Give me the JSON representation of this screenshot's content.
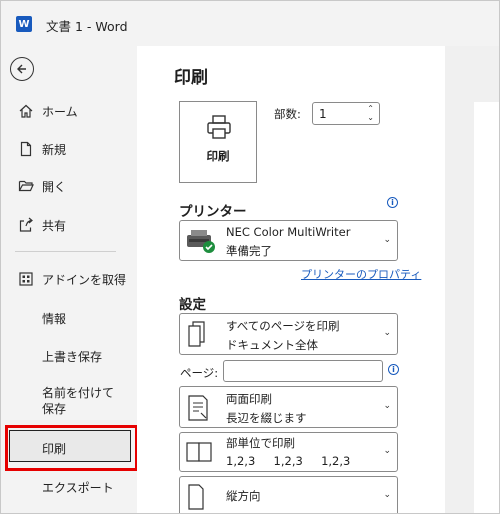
{
  "window": {
    "title": "文書 1  -  Word",
    "app_logo": "W"
  },
  "nav": {
    "items": [
      {
        "label": "ホーム",
        "icon": "home-icon"
      },
      {
        "label": "新規",
        "icon": "new-document-icon"
      },
      {
        "label": "開く",
        "icon": "folder-open-icon"
      },
      {
        "label": "共有",
        "icon": "share-icon"
      },
      {
        "label": "アドインを取得",
        "icon": "addin-icon"
      },
      {
        "label": "情報"
      },
      {
        "label": "上書き保存"
      },
      {
        "label": "名前を付けて保存"
      },
      {
        "label": "印刷",
        "selected": true
      },
      {
        "label": "エクスポート"
      }
    ]
  },
  "main": {
    "title": "印刷",
    "print_button_label": "印刷",
    "copies_label": "部数:",
    "copies_value": "1",
    "printer_heading": "プリンター",
    "printer_name": "NEC Color MultiWriter",
    "printer_status": "準備完了",
    "printer_properties_link": "プリンターのプロパティ",
    "settings_heading": "設定",
    "settings": [
      {
        "line1": "すべてのページを印刷",
        "line2": "ドキュメント全体",
        "icon": "pages-icon"
      },
      {
        "line1": "両面印刷",
        "line2": "長辺を綴じます",
        "icon": "duplex-icon"
      },
      {
        "line1": "部単位で印刷",
        "line2": "1,2,3     1,2,3     1,2,3",
        "icon": "collate-icon"
      },
      {
        "line1": "縦方向",
        "line2": "",
        "icon": "portrait-icon"
      }
    ],
    "pages_label": "ページ:",
    "pages_value": ""
  },
  "colors": {
    "accent": "#185abd",
    "highlight": "#e60000",
    "nav_bg": "#f3f3f3"
  }
}
